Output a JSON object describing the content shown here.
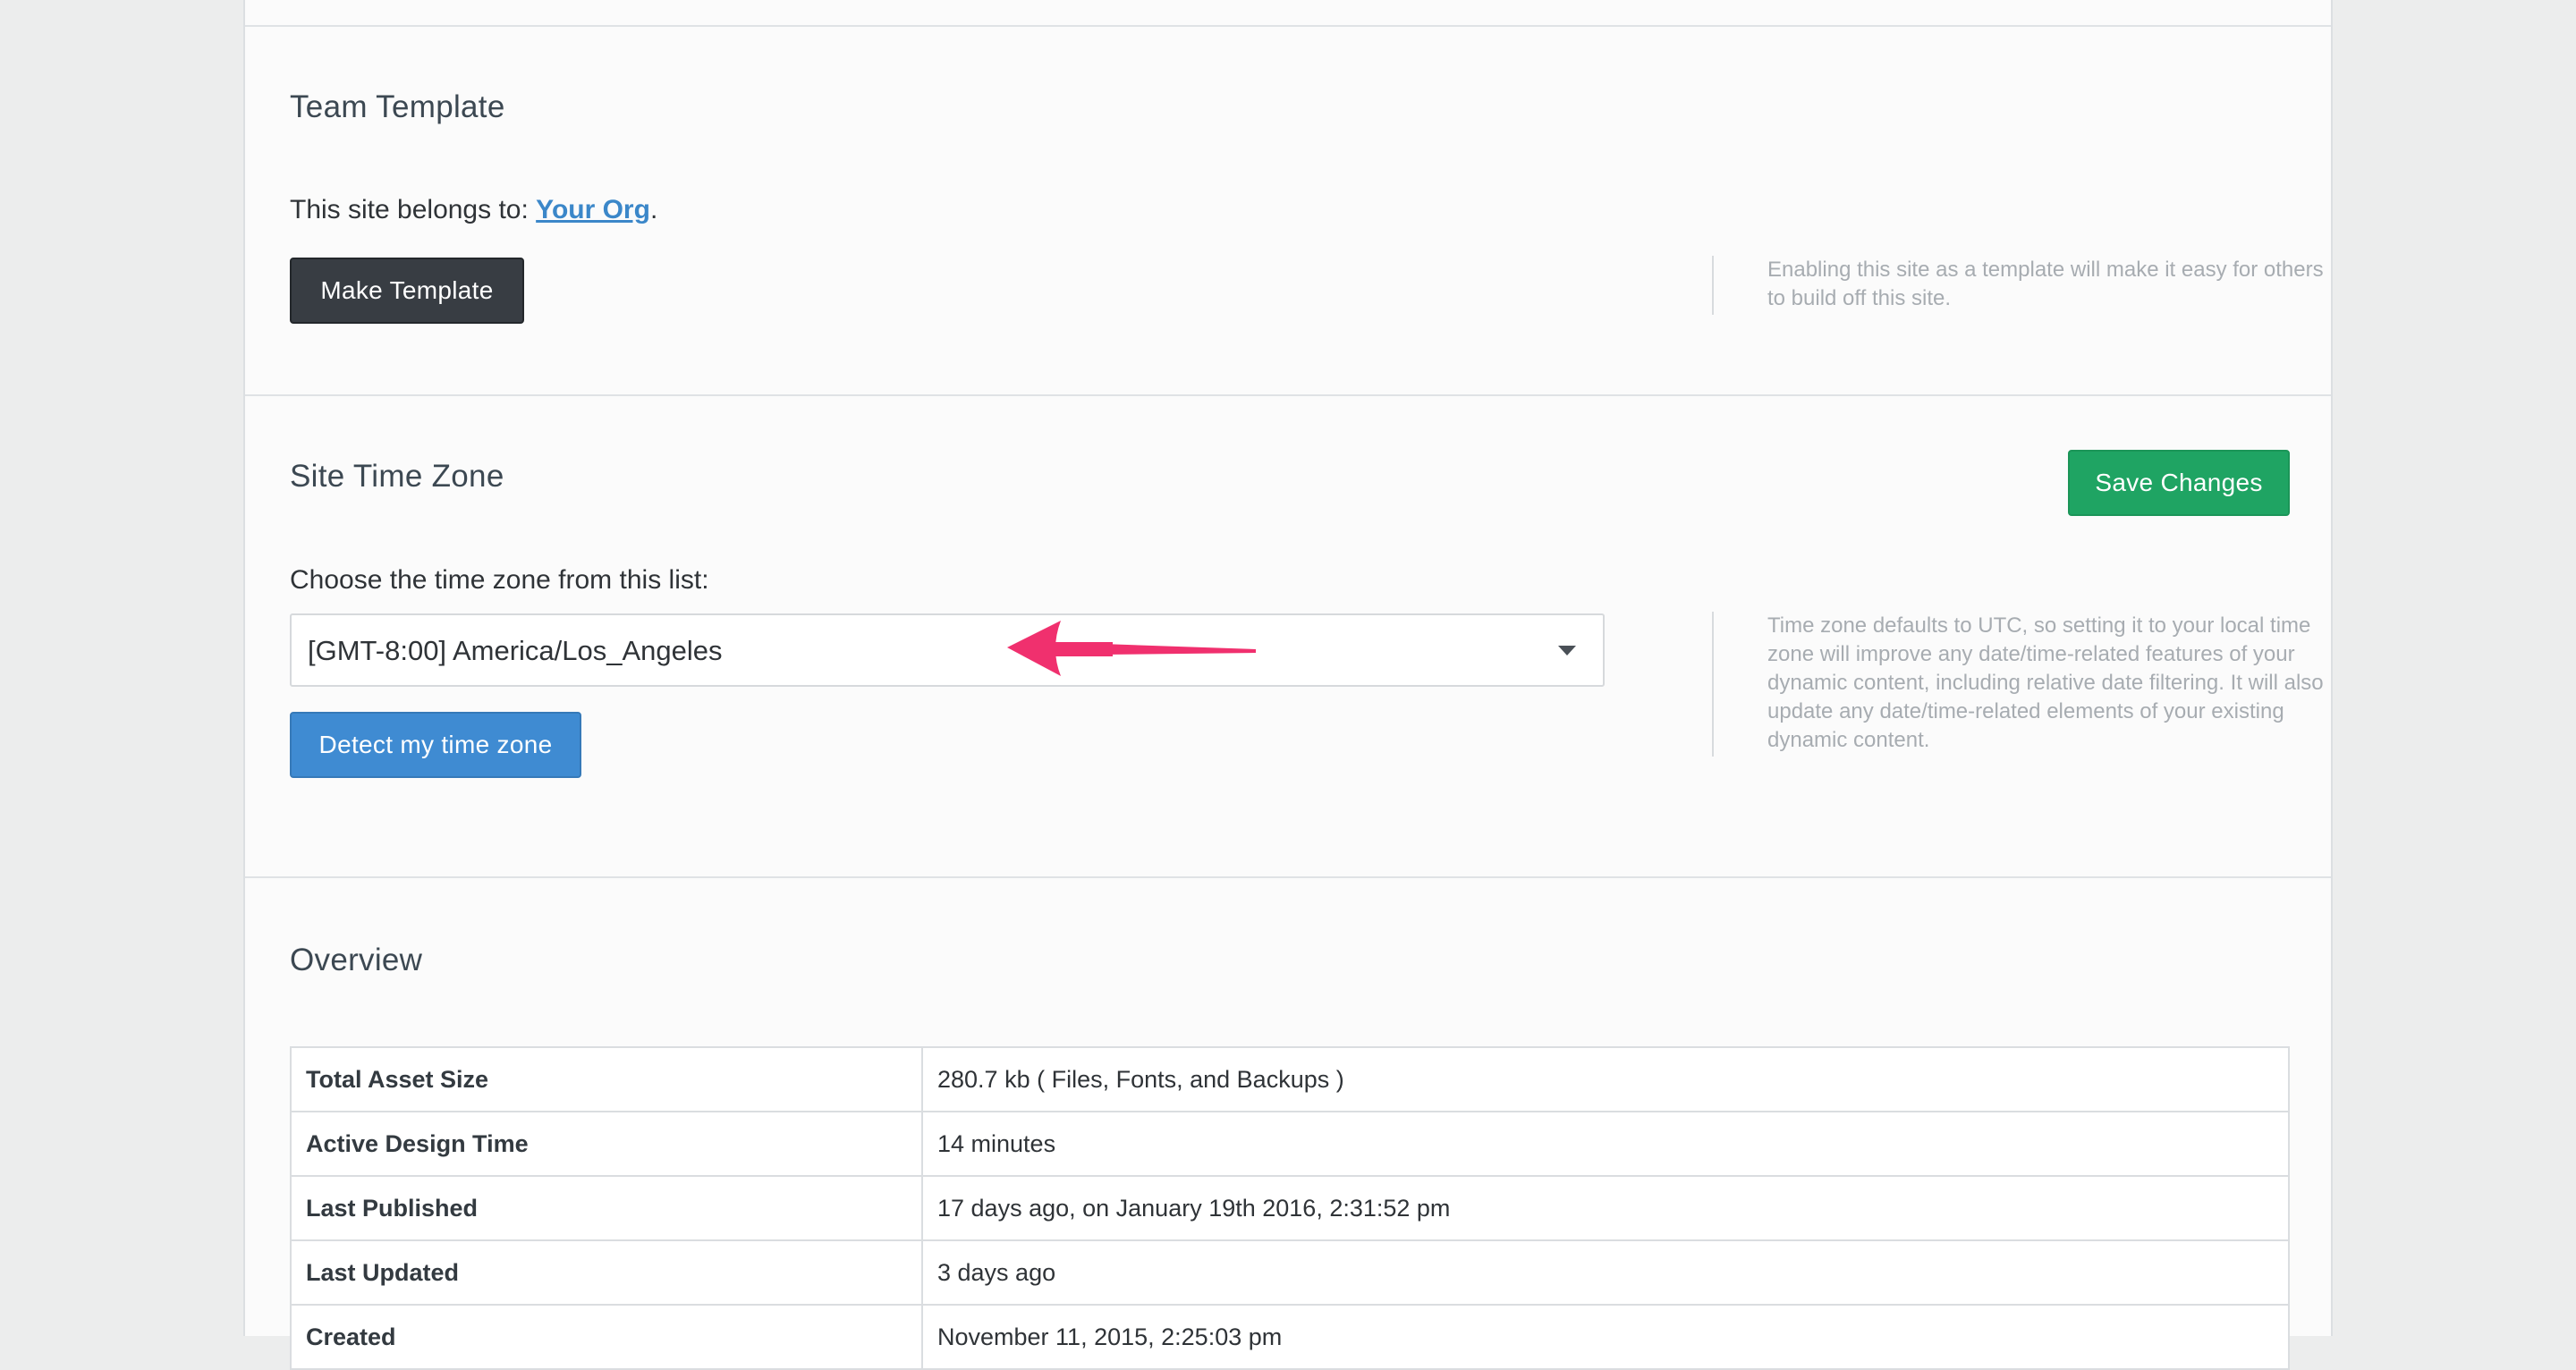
{
  "team_template": {
    "title": "Team Template",
    "belongs_prefix": "This site belongs to: ",
    "org_link": "Your Org",
    "belongs_suffix": ".",
    "make_template_label": "Make Template",
    "help_text": "Enabling this site as a template will make it easy for others to build off this site."
  },
  "time_zone": {
    "title": "Site Time Zone",
    "save_label": "Save Changes",
    "choose_label": "Choose the time zone from this list:",
    "selected_value": "[GMT-8:00] America/Los_Angeles",
    "detect_label": "Detect my time zone",
    "help_text": "Time zone defaults to UTC, so setting it to your local time zone will improve any date/time-related features of your dynamic content, including relative date filtering. It will also update any date/time-related elements of your existing dynamic content.",
    "annotation_color": "#f0306e"
  },
  "overview": {
    "title": "Overview",
    "rows": [
      {
        "key": "Total Asset Size",
        "value": "280.7 kb ( Files, Fonts, and Backups )"
      },
      {
        "key": "Active Design Time",
        "value": "14 minutes"
      },
      {
        "key": "Last Published",
        "value": "17 days ago, on January 19th 2016, 2:31:52 pm"
      },
      {
        "key": "Last Updated",
        "value": "3 days ago"
      },
      {
        "key": "Created",
        "value": "November 11, 2015, 2:25:03 pm"
      }
    ]
  }
}
